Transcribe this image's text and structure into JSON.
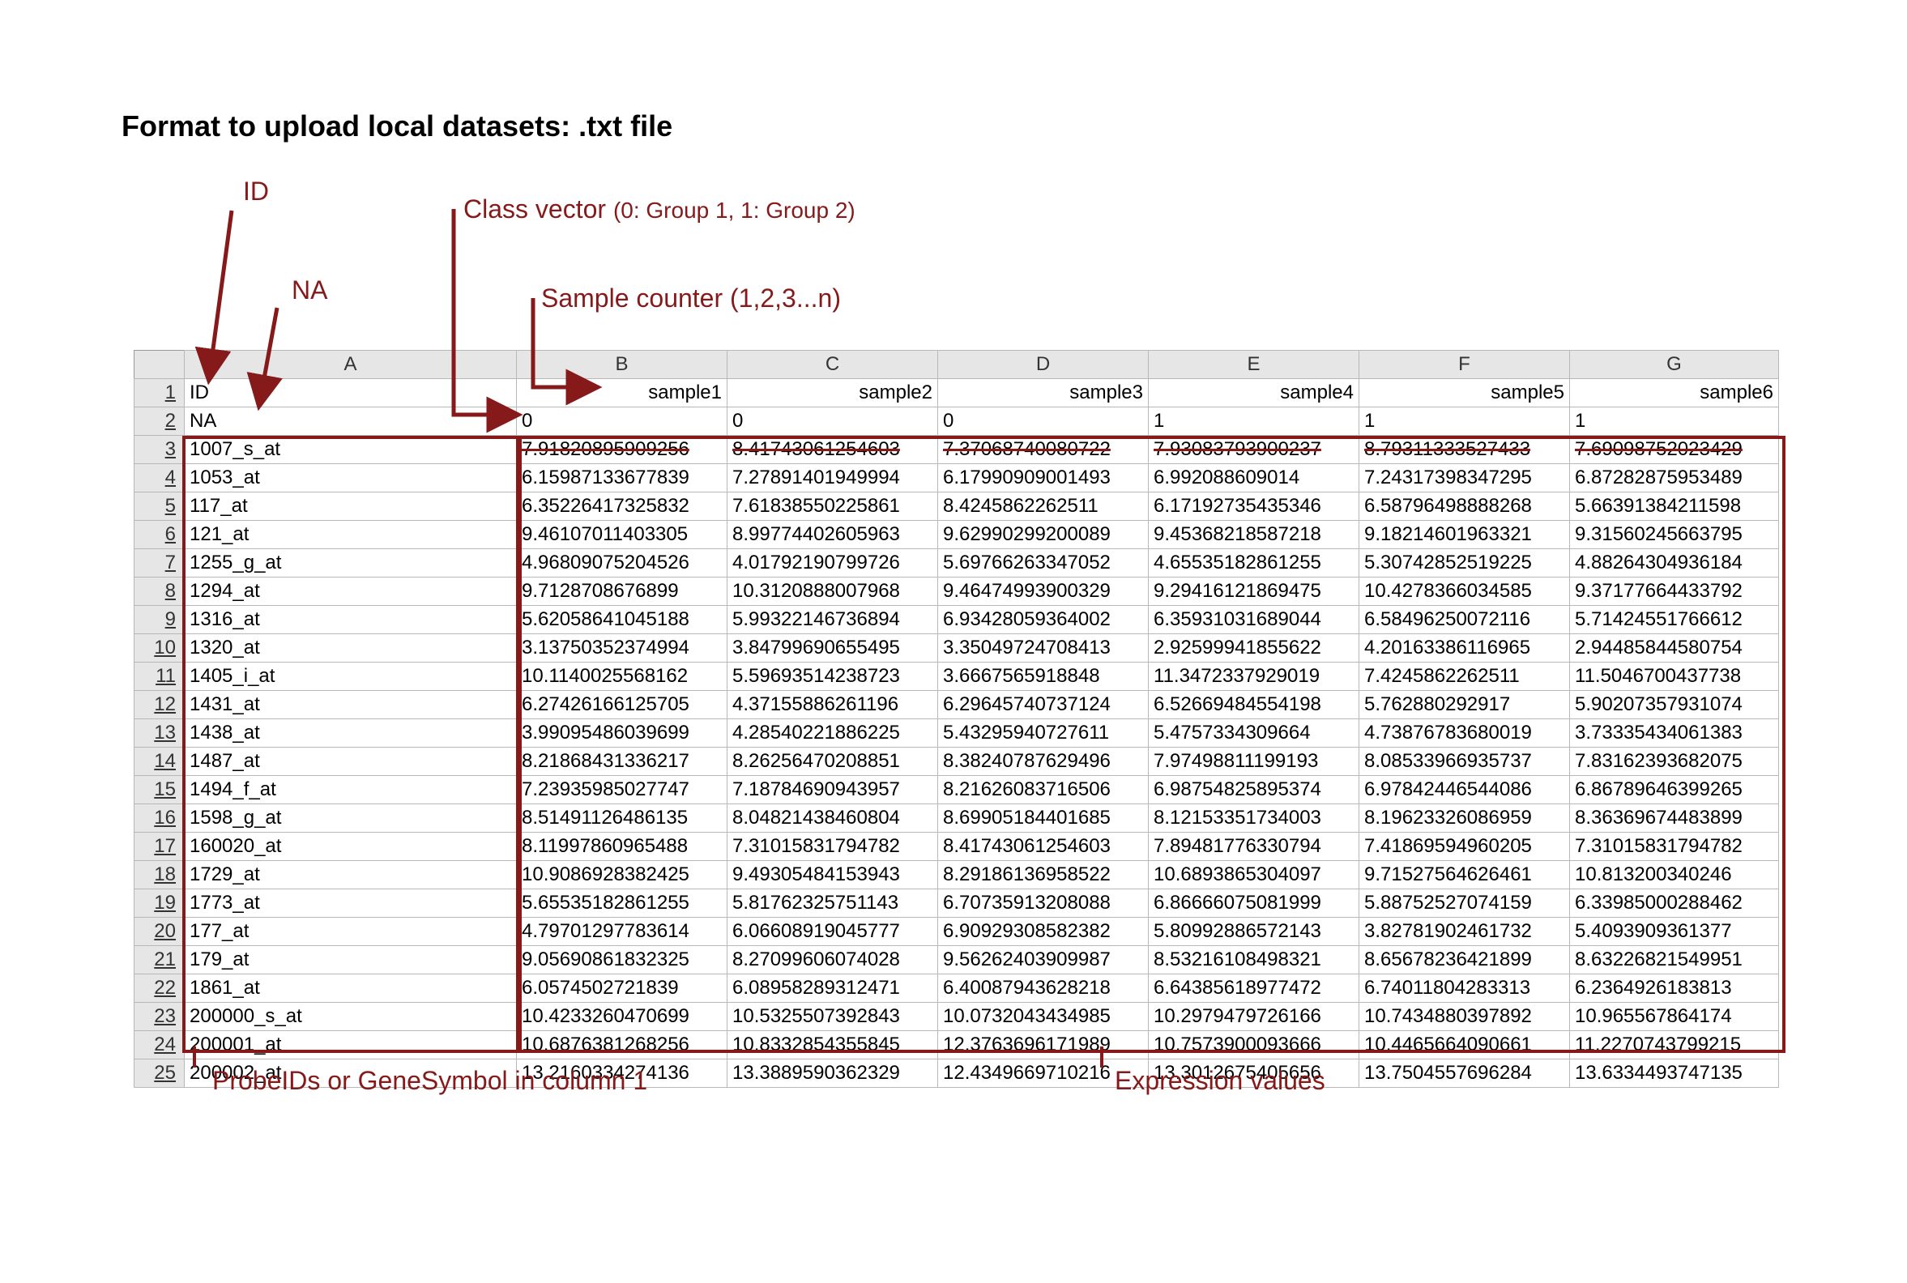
{
  "title": "Format to upload local datasets: .txt file",
  "annotations": {
    "id": "ID",
    "na": "NA",
    "class_vector": "Class vector",
    "class_vector_sub": "(0: Group 1, 1: Group 2)",
    "sample_counter": "Sample counter (1,2,3...n)",
    "probe_col": "ProbeIDs or GeneSymbol in column 1",
    "expr_vals": "Expression values"
  },
  "sheet": {
    "col_letters": [
      "A",
      "B",
      "C",
      "D",
      "E",
      "F",
      "G"
    ],
    "row1": {
      "id": "ID",
      "samples": [
        "sample1",
        "sample2",
        "sample3",
        "sample4",
        "sample5",
        "sample6"
      ]
    },
    "row2": {
      "id": "NA",
      "classes": [
        "0",
        "0",
        "0",
        "1",
        "1",
        "1"
      ]
    },
    "data_rows": [
      {
        "n": 3,
        "id": "1007_s_at",
        "v": [
          "7.91820895909256",
          "8.41743061254603",
          "7.37068740080722",
          "7.93083793900237",
          "8.79311333527433",
          "7.69098752023429"
        ]
      },
      {
        "n": 4,
        "id": "1053_at",
        "v": [
          "6.15987133677839",
          "7.27891401949994",
          "6.17990909001493",
          "6.992088609014",
          "7.24317398347295",
          "6.87282875953489"
        ]
      },
      {
        "n": 5,
        "id": "117_at",
        "v": [
          "6.35226417325832",
          "7.61838550225861",
          "8.4245862262511",
          "6.17192735435346",
          "6.58796498888268",
          "5.66391384211598"
        ]
      },
      {
        "n": 6,
        "id": "121_at",
        "v": [
          "9.46107011403305",
          "8.99774402605963",
          "9.62990299200089",
          "9.45368218587218",
          "9.18214601963321",
          "9.31560245663795"
        ]
      },
      {
        "n": 7,
        "id": "1255_g_at",
        "v": [
          "4.96809075204526",
          "4.01792190799726",
          "5.69766263347052",
          "4.65535182861255",
          "5.30742852519225",
          "4.88264304936184"
        ]
      },
      {
        "n": 8,
        "id": "1294_at",
        "v": [
          "9.7128708676899",
          "10.3120888007968",
          "9.46474993900329",
          "9.29416121869475",
          "10.4278366034585",
          "9.37177664433792"
        ]
      },
      {
        "n": 9,
        "id": "1316_at",
        "v": [
          "5.62058641045188",
          "5.99322146736894",
          "6.93428059364002",
          "6.35931031689044",
          "6.58496250072116",
          "5.71424551766612"
        ]
      },
      {
        "n": 10,
        "id": "1320_at",
        "v": [
          "3.13750352374994",
          "3.84799690655495",
          "3.35049724708413",
          "2.92599941855622",
          "4.20163386116965",
          "2.94485844580754"
        ]
      },
      {
        "n": 11,
        "id": "1405_i_at",
        "v": [
          "10.1140025568162",
          "5.59693514238723",
          "3.6667565918848",
          "11.3472337929019",
          "7.4245862262511",
          "11.5046700437738"
        ]
      },
      {
        "n": 12,
        "id": "1431_at",
        "v": [
          "6.27426166125705",
          "4.37155886261196",
          "6.29645740737124",
          "6.52669484554198",
          "5.762880292917",
          "5.90207357931074"
        ]
      },
      {
        "n": 13,
        "id": "1438_at",
        "v": [
          "3.99095486039699",
          "4.28540221886225",
          "5.43295940727611",
          "5.4757334309664",
          "4.73876783680019",
          "3.73335434061383"
        ]
      },
      {
        "n": 14,
        "id": "1487_at",
        "v": [
          "8.21868431336217",
          "8.26256470208851",
          "8.38240787629496",
          "7.97498811199193",
          "8.08533966935737",
          "7.83162393682075"
        ]
      },
      {
        "n": 15,
        "id": "1494_f_at",
        "v": [
          "7.23935985027747",
          "7.18784690943957",
          "8.21626083716506",
          "6.98754825895374",
          "6.97842446544086",
          "6.86789646399265"
        ]
      },
      {
        "n": 16,
        "id": "1598_g_at",
        "v": [
          "8.51491126486135",
          "8.04821438460804",
          "8.69905184401685",
          "8.12153351734003",
          "8.19623326086959",
          "8.36369674483899"
        ]
      },
      {
        "n": 17,
        "id": "160020_at",
        "v": [
          "8.11997860965488",
          "7.31015831794782",
          "8.41743061254603",
          "7.89481776330794",
          "7.41869594960205",
          "7.31015831794782"
        ]
      },
      {
        "n": 18,
        "id": "1729_at",
        "v": [
          "10.9086928382425",
          "9.49305484153943",
          "8.29186136958522",
          "10.6893865304097",
          "9.71527564626461",
          "10.813200340246"
        ]
      },
      {
        "n": 19,
        "id": "1773_at",
        "v": [
          "5.65535182861255",
          "5.81762325751143",
          "6.70735913208088",
          "6.86666075081999",
          "5.88752527074159",
          "6.33985000288462"
        ]
      },
      {
        "n": 20,
        "id": "177_at",
        "v": [
          "4.79701297783614",
          "6.06608919045777",
          "6.90929308582382",
          "5.80992886572143",
          "3.82781902461732",
          "5.4093909361377"
        ]
      },
      {
        "n": 21,
        "id": "179_at",
        "v": [
          "9.05690861832325",
          "8.27099606074028",
          "9.56262403909987",
          "8.53216108498321",
          "8.65678236421899",
          "8.63226821549951"
        ]
      },
      {
        "n": 22,
        "id": "1861_at",
        "v": [
          "6.0574502721839",
          "6.08958289312471",
          "6.40087943628218",
          "6.64385618977472",
          "6.74011804283313",
          "6.2364926183813"
        ]
      },
      {
        "n": 23,
        "id": "200000_s_at",
        "v": [
          "10.4233260470699",
          "10.5325507392843",
          "10.0732043434985",
          "10.2979479726166",
          "10.7434880397892",
          "10.965567864174"
        ]
      },
      {
        "n": 24,
        "id": "200001_at",
        "v": [
          "10.6876381268256",
          "10.8332854355845",
          "12.3763696171989",
          "10.7573900093666",
          "10.4465664090661",
          "11.2270743799215"
        ]
      },
      {
        "n": 25,
        "id": "200002_at",
        "v": [
          "13.2160334274136",
          "13.3889590362329",
          "12.4349669710216",
          "13.3012675405656",
          "13.7504557696284",
          "13.6334493747135"
        ]
      }
    ]
  },
  "colors": {
    "callout": "#861a1a"
  }
}
